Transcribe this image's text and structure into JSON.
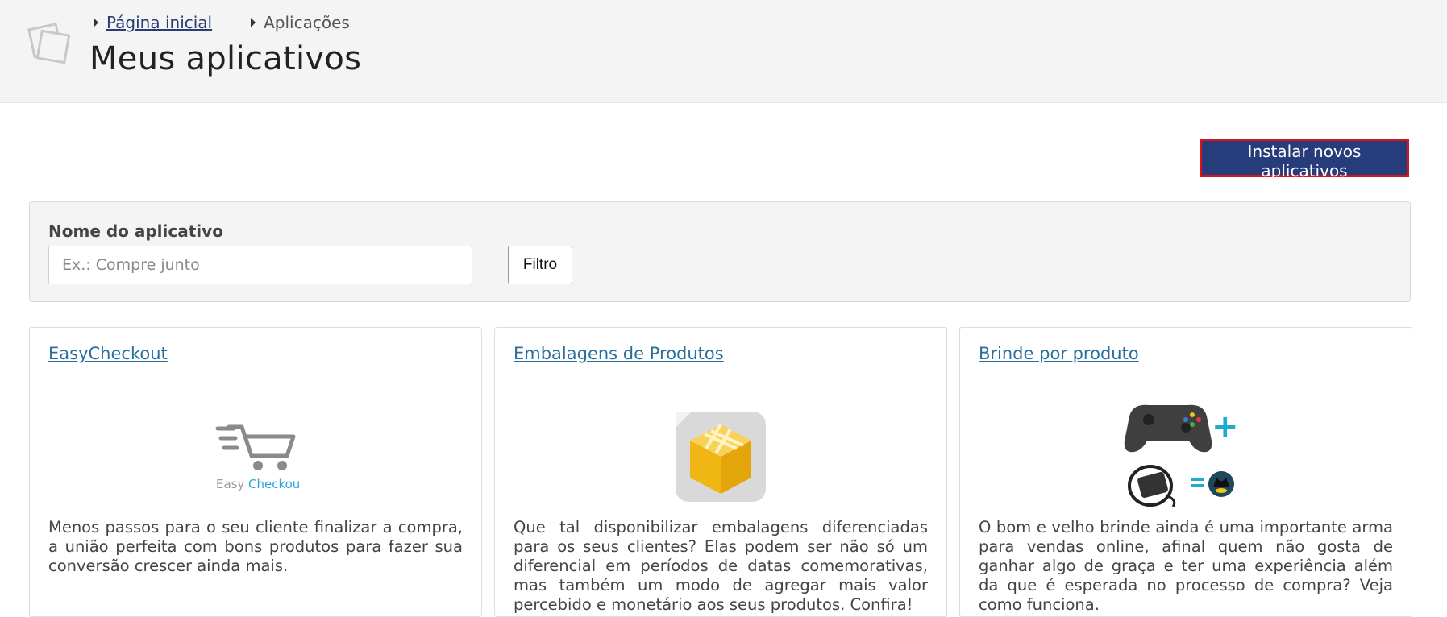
{
  "breadcrumb": {
    "home": "Página inicial",
    "current": "Aplicações"
  },
  "page": {
    "title": "Meus aplicativos"
  },
  "actions": {
    "install_label": "Instalar novos aplicativos"
  },
  "filter": {
    "label": "Nome do aplicativo",
    "placeholder": "Ex.: Compre junto",
    "button_label": "Filtro"
  },
  "apps": [
    {
      "title": "EasyCheckout",
      "logo_text_a": "Easy",
      "logo_text_b": "Checkout",
      "description": "Menos passos para o seu cliente finalizar a compra, a união perfeita com bons produtos para fazer sua conversão crescer ainda mais.",
      "icon": "shopping-cart-icon"
    },
    {
      "title": "Embalagens de Produtos",
      "description": "Que tal disponibilizar embalagens diferenciadas para os seus clientes? Elas podem ser não só um diferencial em períodos de datas comemorativas, mas também um modo de agregar mais valor percebido e monetário aos seus produtos. Confira!",
      "icon": "gift-box-icon"
    },
    {
      "title": "Brinde por produto",
      "description": "O bom e velho brinde ainda é uma importante arma para vendas online, afinal quem não gosta de ganhar algo de graça e ter uma experiência além da que é esperada no processo de compra? Veja como funciona.",
      "icon": "gamepad-gift-icon"
    }
  ],
  "colors": {
    "primary": "#273c7b",
    "highlight": "#e0101a",
    "link": "#2a6f9b",
    "header_bg": "#f4f4f4"
  }
}
